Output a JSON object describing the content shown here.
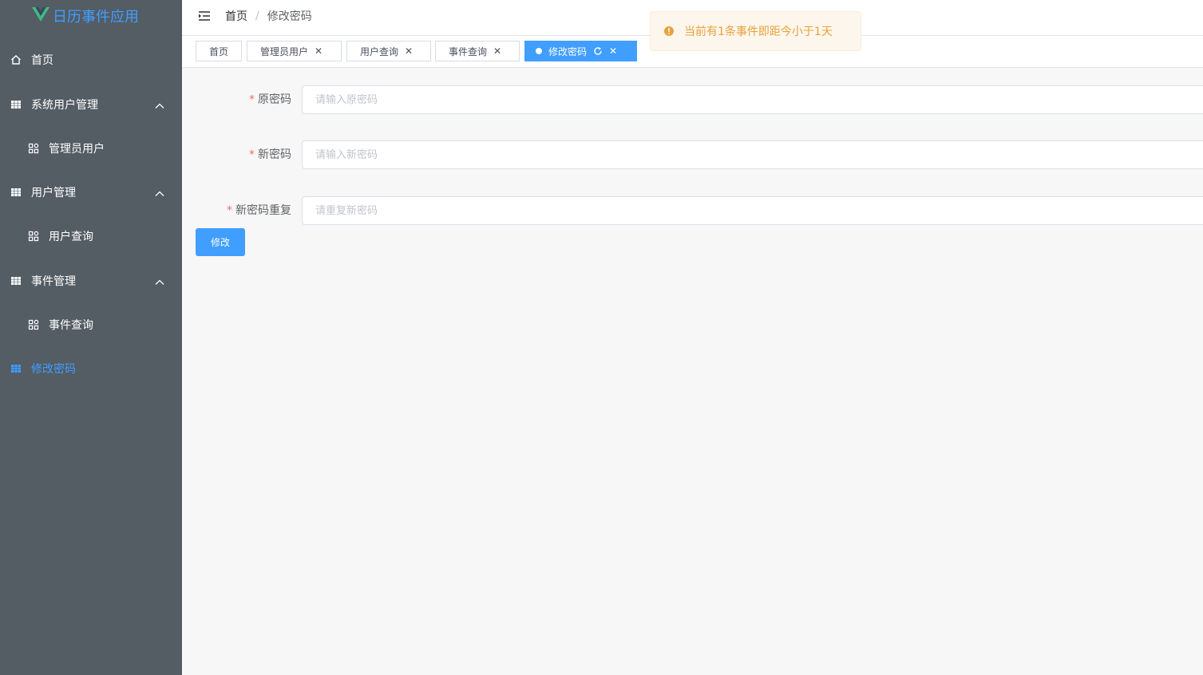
{
  "app": {
    "title": "日历事件应用"
  },
  "sidebar": {
    "items": [
      {
        "label": "首页"
      },
      {
        "label": "系统用户管理"
      },
      {
        "label": "管理员用户"
      },
      {
        "label": "用户管理"
      },
      {
        "label": "用户查询"
      },
      {
        "label": "事件管理"
      },
      {
        "label": "事件查询"
      },
      {
        "label": "修改密码"
      }
    ],
    "active_color": "#409eff",
    "background": "#545c64"
  },
  "breadcrumb": {
    "home": "首页",
    "separator": "/",
    "current": "修改密码"
  },
  "tags": [
    {
      "label": "首页"
    },
    {
      "label": "管理员用户"
    },
    {
      "label": "用户查询"
    },
    {
      "label": "事件查询"
    },
    {
      "label": "修改密码"
    }
  ],
  "notice": {
    "text": "当前有1条事件即距今小于1天"
  },
  "form": {
    "required_mark": "*",
    "fields": [
      {
        "label": "原密码",
        "placeholder": "请输入原密码",
        "value": ""
      },
      {
        "label": "新密码",
        "placeholder": "请输入新密码",
        "value": ""
      },
      {
        "label": "新密码重复",
        "placeholder": "请重复新密码",
        "value": ""
      }
    ],
    "submit_label": "修改"
  },
  "colors": {
    "primary": "#409eff",
    "warning": "#e6a23c",
    "danger": "#f56c6c"
  }
}
